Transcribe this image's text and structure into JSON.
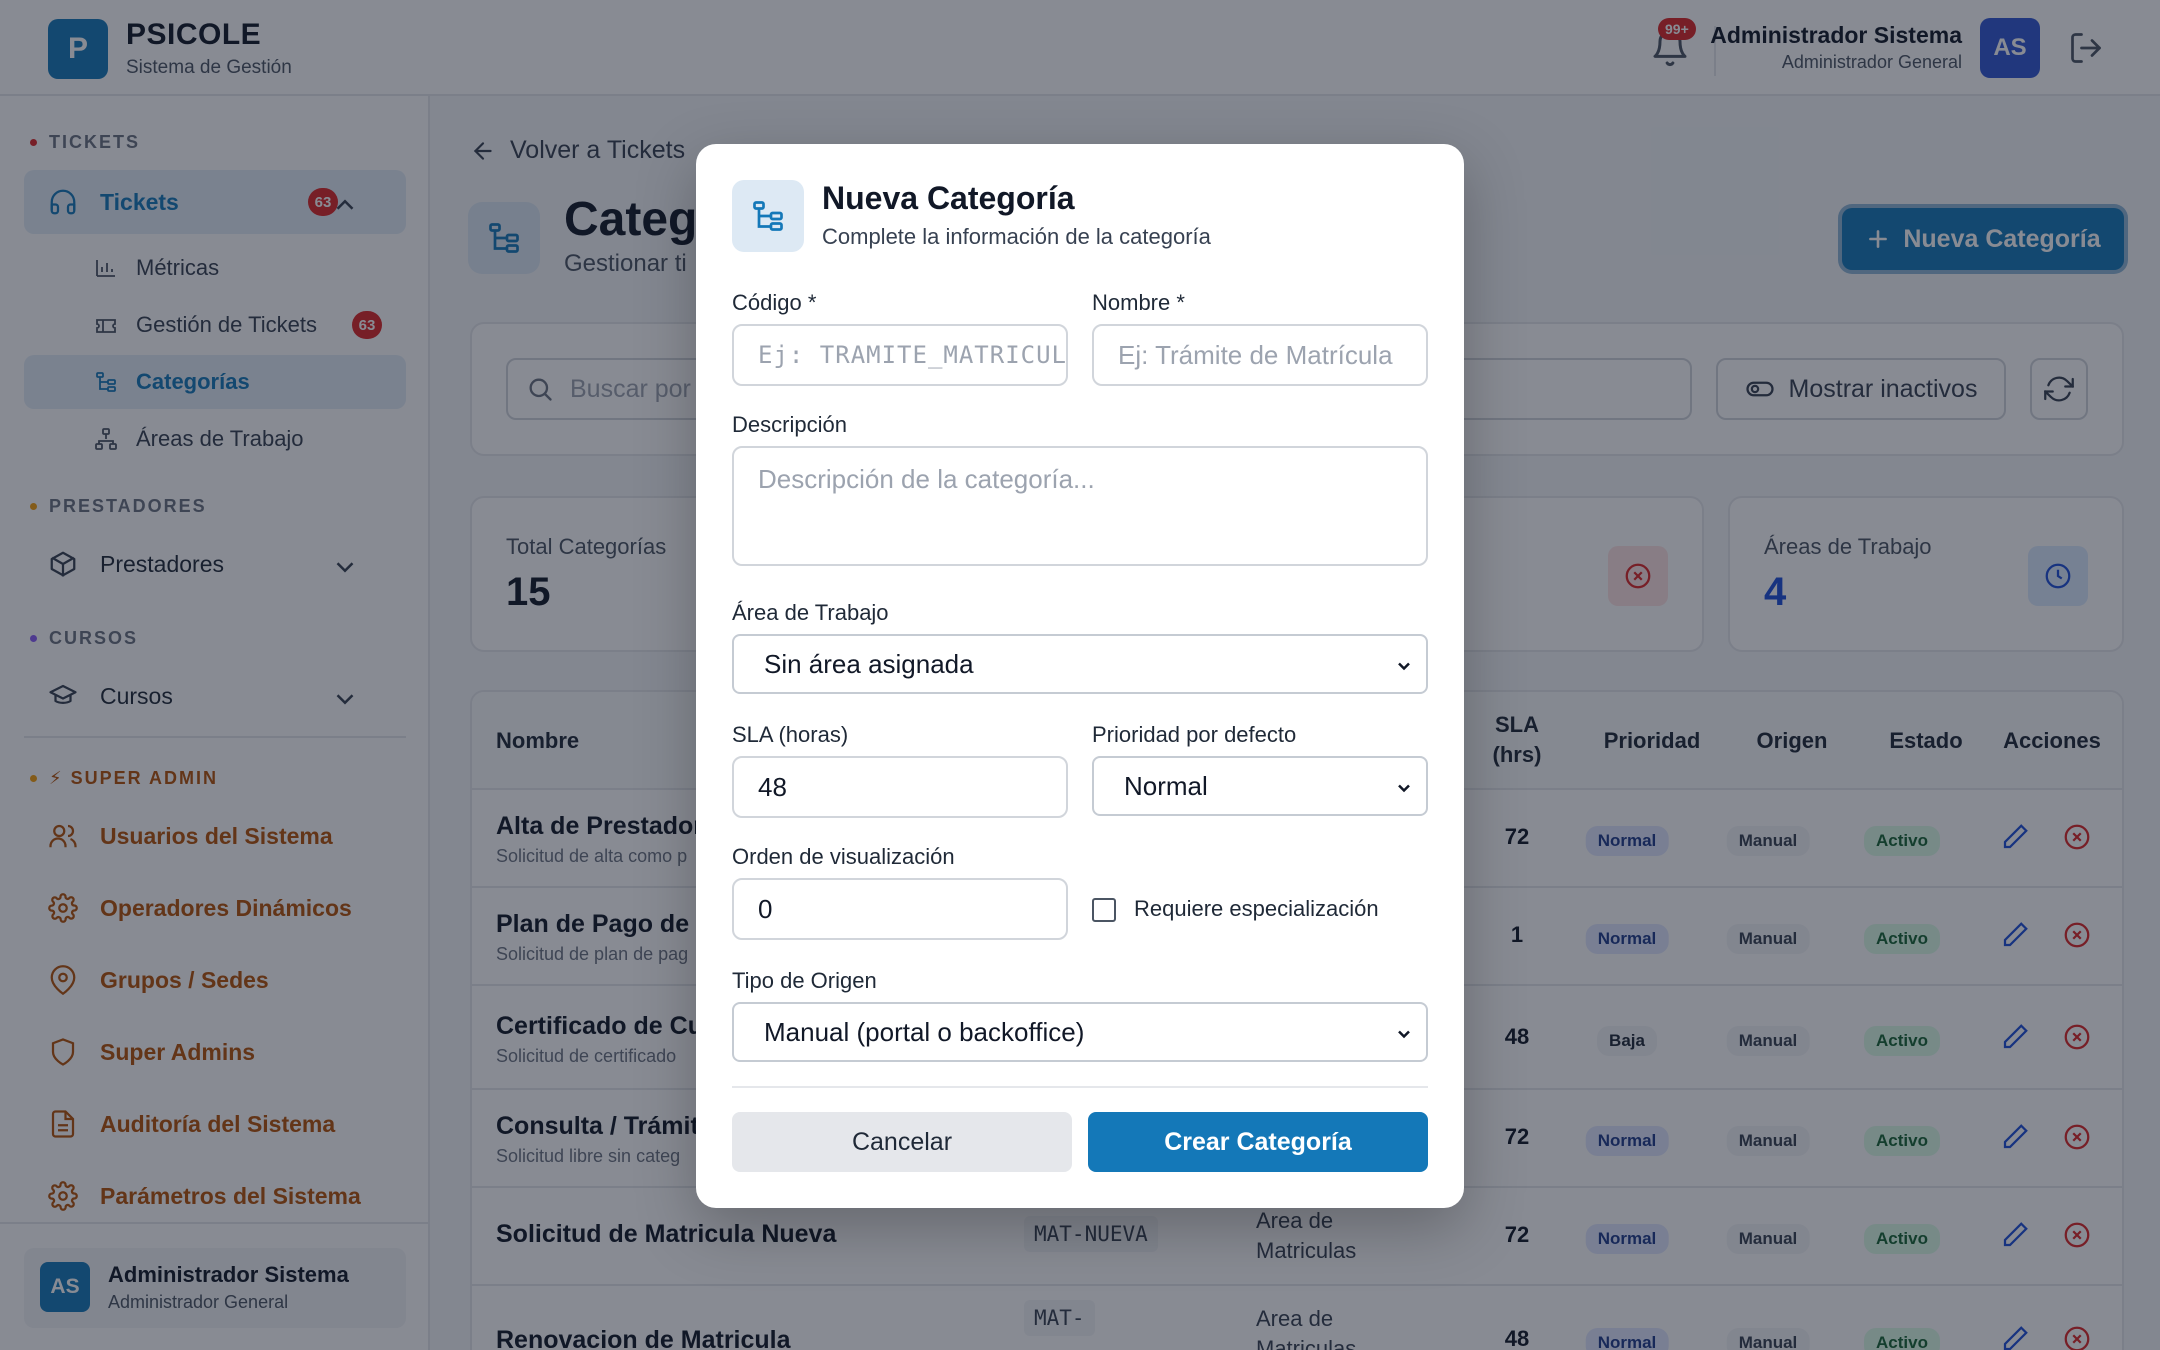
{
  "header": {
    "logo_letter": "P",
    "brand_title": "PSICOLE",
    "brand_subtitle": "Sistema de Gestión",
    "notification_badge": "99+",
    "user_name": "Administrador Sistema",
    "user_role": "Administrador General",
    "avatar_initials": "AS"
  },
  "sidebar": {
    "sections": {
      "tickets": "TICKETS",
      "prestadores": "PRESTADORES",
      "cursos": "CURSOS",
      "super_admin": "⚡ SUPER ADMIN"
    },
    "tickets_item": {
      "label": "Tickets",
      "badge": "63"
    },
    "ticket_subitems": [
      {
        "label": "Métricas",
        "icon": "chart-icon"
      },
      {
        "label": "Gestión de Tickets",
        "icon": "ticket-icon",
        "badge": "63"
      },
      {
        "label": "Categorías",
        "icon": "category-tree-icon"
      },
      {
        "label": "Áreas de Trabajo",
        "icon": "org-chart-icon"
      }
    ],
    "prestadores_item": {
      "label": "Prestadores"
    },
    "cursos_item": {
      "label": "Cursos"
    },
    "admin_items": [
      {
        "label": "Usuarios del Sistema",
        "icon": "users-icon"
      },
      {
        "label": "Operadores Dinámicos",
        "icon": "gear-icon"
      },
      {
        "label": "Grupos / Sedes",
        "icon": "map-pin-icon"
      },
      {
        "label": "Super Admins",
        "icon": "shield-icon"
      },
      {
        "label": "Auditoría del Sistema",
        "icon": "document-icon"
      },
      {
        "label": "Parámetros del Sistema",
        "icon": "gear-icon"
      }
    ],
    "user": {
      "initials": "AS",
      "name": "Administrador Sistema",
      "role": "Administrador General"
    }
  },
  "main": {
    "back_link": "Volver a Tickets",
    "title": "Categ",
    "subtitle": "Gestionar ti",
    "new_button": "Nueva Categoría",
    "search_placeholder": "Buscar por",
    "show_inactive": "Mostrar inactivos",
    "stats": [
      {
        "label": "Total Categorías",
        "value": "15"
      },
      {
        "label": "Áreas de Trabajo",
        "value": "4"
      }
    ],
    "table": {
      "headers": [
        "Nombre",
        "SLA (hrs)",
        "Prioridad",
        "Origen",
        "Estado",
        "Acciones"
      ],
      "sla_header_line1": "SLA",
      "sla_header_line2": "(hrs)",
      "rows": [
        {
          "name": "Alta de Prestador",
          "desc": "Solicitud de alta como p",
          "sla": "72",
          "priority": "Normal",
          "origin": "Manual",
          "status": "Activo"
        },
        {
          "name": "Plan de Pago de D",
          "desc": "Solicitud de plan de pag",
          "sla": "1",
          "priority": "Normal",
          "origin": "Manual",
          "status": "Activo"
        },
        {
          "name": "Certificado de Cu",
          "desc": "Solicitud de certificado",
          "sla": "48",
          "priority": "Baja",
          "origin": "Manual",
          "status": "Activo"
        },
        {
          "name": "Consulta / Trámite",
          "desc": "Solicitud libre sin categ",
          "sla": "72",
          "priority": "Normal",
          "origin": "Manual",
          "status": "Activo"
        },
        {
          "name": "Solicitud de Matricula Nueva",
          "desc": "",
          "code": "MAT-NUEVA",
          "area_line1": "Area de",
          "area_line2": "Matriculas",
          "sla": "72",
          "priority": "Normal",
          "origin": "Manual",
          "status": "Activo"
        },
        {
          "name": "Renovacion de Matricula",
          "desc": "",
          "code": "MAT-",
          "area_line1": "Area de",
          "area_line2": "Matriculas",
          "sla": "48",
          "priority": "Normal",
          "origin": "Manual",
          "status": "Activo"
        }
      ]
    }
  },
  "modal": {
    "title": "Nueva Categoría",
    "subtitle": "Complete la información de la categoría",
    "codigo_label": "Código *",
    "codigo_placeholder": "Ej: TRAMITE_MATRICULA",
    "nombre_label": "Nombre *",
    "nombre_placeholder": "Ej: Trámite de Matrícula",
    "descripcion_label": "Descripción",
    "descripcion_placeholder": "Descripción de la categoría...",
    "area_label": "Área de Trabajo",
    "area_value": "Sin área asignada",
    "sla_label": "SLA (horas)",
    "sla_value": "48",
    "prioridad_label": "Prioridad por defecto",
    "prioridad_value": "Normal",
    "orden_label": "Orden de visualización",
    "orden_value": "0",
    "especializacion_label": "Requiere especialización",
    "especializacion_checked": false,
    "origen_label": "Tipo de Origen",
    "origen_value": "Manual (portal o backoffice)",
    "cancel": "Cancelar",
    "create": "Crear Categoría"
  },
  "colors": {
    "primary": "#1478b8",
    "admin_accent": "#b45309",
    "danger": "#dc2626",
    "overlay": "rgba(17,24,39,0.5)"
  }
}
